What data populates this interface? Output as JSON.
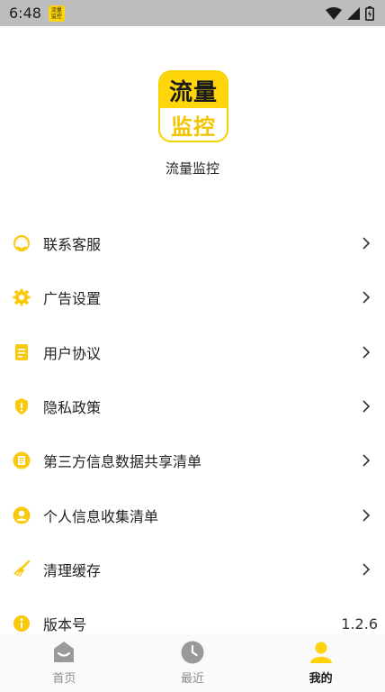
{
  "status_bar": {
    "time": "6:48",
    "app_icon_top": "流量",
    "app_icon_bottom": "监控"
  },
  "logo": {
    "top": "流量",
    "bottom": "监控"
  },
  "app_name": "流量监控",
  "menu": {
    "items": [
      {
        "label": "联系客服",
        "icon": "headset-icon"
      },
      {
        "label": "广告设置",
        "icon": "gear-icon"
      },
      {
        "label": "用户协议",
        "icon": "document-icon"
      },
      {
        "label": "隐私政策",
        "icon": "shield-icon"
      },
      {
        "label": "第三方信息数据共享清单",
        "icon": "list-doc-icon"
      },
      {
        "label": "个人信息收集清单",
        "icon": "person-icon"
      },
      {
        "label": "清理缓存",
        "icon": "broom-icon"
      },
      {
        "label": "版本号",
        "icon": "info-icon",
        "value": "1.2.6"
      }
    ]
  },
  "tabs": [
    {
      "label": "首页",
      "icon": "home-icon",
      "active": false
    },
    {
      "label": "最近",
      "icon": "clock-icon",
      "active": false
    },
    {
      "label": "我的",
      "icon": "user-icon",
      "active": true
    }
  ],
  "colors": {
    "accent": "#ffd60a",
    "inactive": "#8c8c8c",
    "status_bar": "#bdbdbd"
  }
}
